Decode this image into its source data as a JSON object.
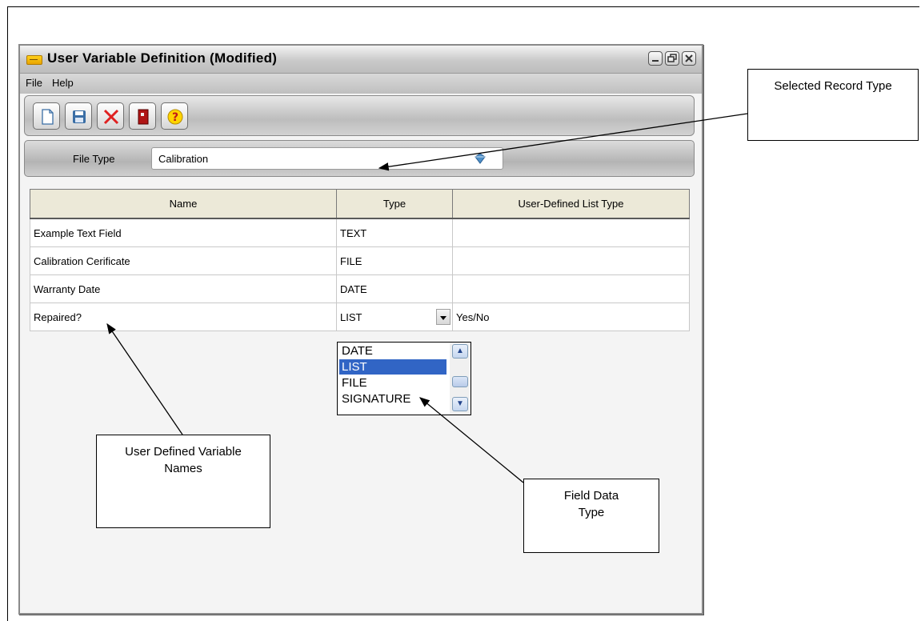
{
  "window": {
    "title": "User  Variable Definition (Modified)"
  },
  "menu": {
    "file": "File",
    "help": "Help"
  },
  "toolbar": {
    "buttons": [
      "new-document-icon",
      "save-icon",
      "delete-icon",
      "exit-icon",
      "help-icon"
    ]
  },
  "file_type": {
    "label": "File Type",
    "value": "Calibration"
  },
  "grid": {
    "headers": [
      "Name",
      "Type",
      "User-Defined List Type"
    ],
    "rows": [
      {
        "name": "Example Text Field",
        "type": "TEXT",
        "list_type": ""
      },
      {
        "name": "Calibration Cerificate",
        "type": "FILE",
        "list_type": ""
      },
      {
        "name": "Warranty Date",
        "type": "DATE",
        "list_type": ""
      },
      {
        "name": "Repaired?",
        "type": "LIST",
        "list_type": "Yes/No"
      }
    ]
  },
  "type_dropdown": {
    "options": [
      "DATE",
      "LIST",
      "FILE",
      "SIGNATURE"
    ],
    "selected": "LIST"
  },
  "callouts": {
    "record_type": "Selected Record Type",
    "variable_names": "User Defined Variable Names",
    "field_data_type": "Field Data Type"
  },
  "colors": {
    "selection": "#3165c5",
    "header_bg": "#ece9d8"
  }
}
